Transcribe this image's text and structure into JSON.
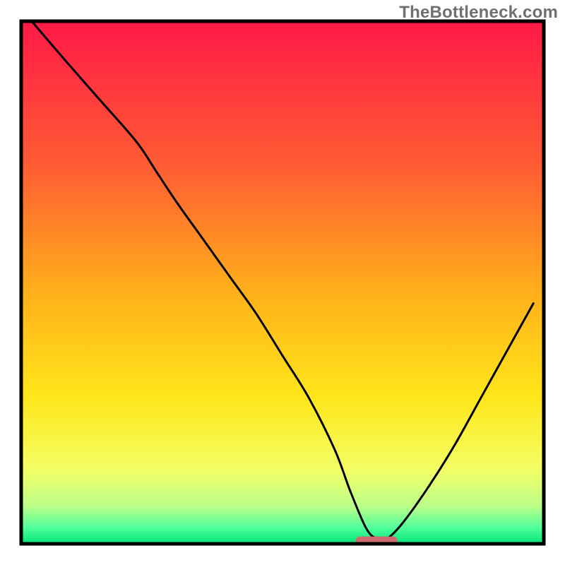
{
  "watermark": "TheBottleneck.com",
  "colors": {
    "frame": "#000000",
    "curve": "#000000",
    "marker": "#d06a6f",
    "gradient_stops": [
      {
        "offset": 0.0,
        "color": "#ff1947"
      },
      {
        "offset": 0.28,
        "color": "#ff5d33"
      },
      {
        "offset": 0.52,
        "color": "#ffb01a"
      },
      {
        "offset": 0.72,
        "color": "#ffe61a"
      },
      {
        "offset": 0.86,
        "color": "#f4ff66"
      },
      {
        "offset": 0.93,
        "color": "#b8ff8a"
      },
      {
        "offset": 0.97,
        "color": "#4dff9a"
      },
      {
        "offset": 1.0,
        "color": "#00e37a"
      }
    ]
  },
  "chart_data": {
    "type": "line",
    "title": "",
    "xlabel": "",
    "ylabel": "",
    "xlim": [
      0,
      100
    ],
    "ylim": [
      0,
      100
    ],
    "grid": false,
    "legend": false,
    "description": "Bottleneck/mismatch curve — y-value is mismatch severity (0 = ideal). Background gradient encodes severity (red high → green low). Curve has a single deep minimum around x ≈ 68.",
    "x": [
      2,
      8,
      15,
      22,
      26,
      30,
      35,
      40,
      45,
      50,
      55,
      60,
      63,
      66,
      68,
      70,
      73,
      78,
      83,
      88,
      93,
      98
    ],
    "y": [
      100,
      93,
      85,
      77,
      71,
      65,
      58,
      51,
      44,
      36,
      28,
      18,
      10,
      3,
      1,
      1,
      4,
      11,
      19,
      28,
      37,
      46
    ],
    "minimum_marker": {
      "x_center": 68,
      "x_half_width": 4,
      "y": 0.6
    }
  }
}
